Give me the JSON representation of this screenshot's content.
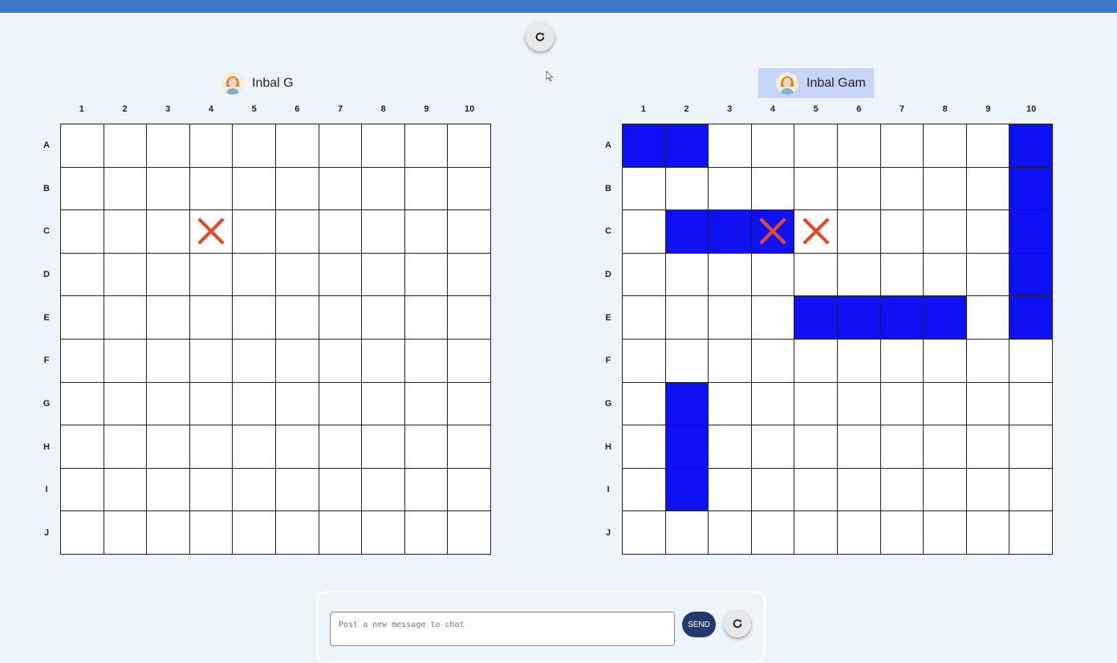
{
  "board_columns": [
    "1",
    "2",
    "3",
    "4",
    "5",
    "6",
    "7",
    "8",
    "9",
    "10"
  ],
  "board_rows": [
    "A",
    "B",
    "C",
    "D",
    "E",
    "F",
    "G",
    "H",
    "I",
    "J"
  ],
  "left_player": {
    "name": "Inbal G",
    "active": false
  },
  "right_player": {
    "name": "Inbal Gam",
    "active": true
  },
  "left_board": {
    "ships": [],
    "hits": [
      "C4"
    ]
  },
  "right_board": {
    "ships": [
      "A1",
      "A2",
      "A10",
      "B10",
      "C2",
      "C3",
      "C4",
      "C10",
      "D10",
      "E5",
      "E6",
      "E7",
      "E8",
      "E10",
      "G2",
      "H2",
      "I2"
    ],
    "hits": [
      "C4",
      "C5"
    ]
  },
  "colors": {
    "ship": "#1010f5",
    "hit_mark": "#e04a2a",
    "accent": "#3f76c9"
  },
  "icons": {
    "refresh": "refresh-icon",
    "hit": "x-mark-icon"
  },
  "chat": {
    "placeholder": "Post a new message to chat",
    "send_label": "SEND"
  }
}
